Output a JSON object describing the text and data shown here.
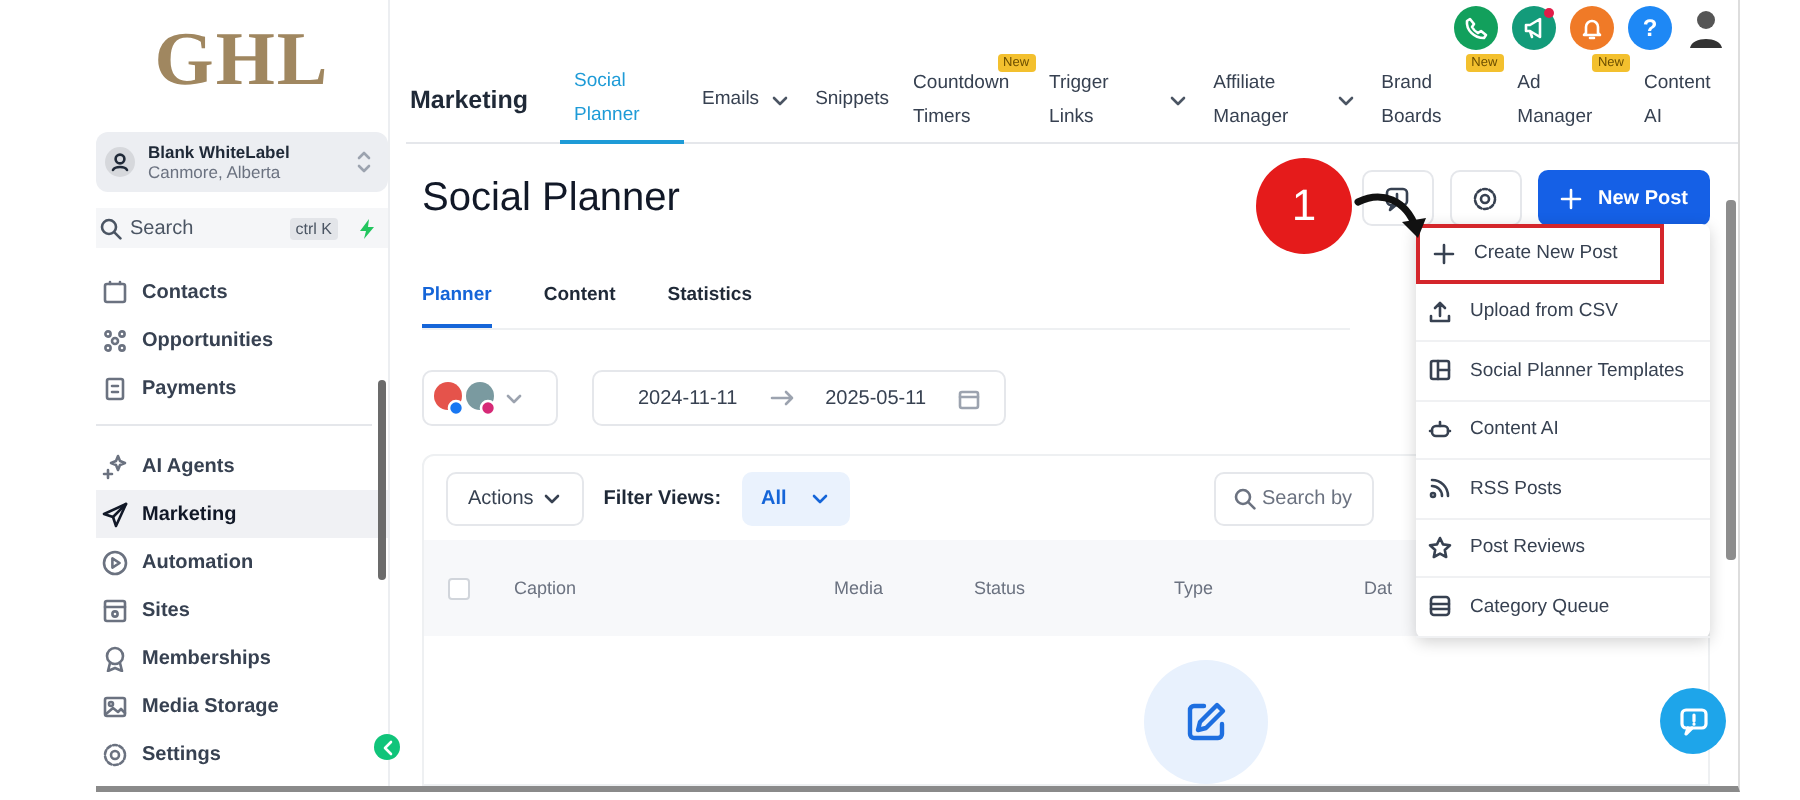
{
  "logo": {
    "text": "GHL"
  },
  "account": {
    "name": "Blank WhiteLabel",
    "location": "Canmore, Alberta"
  },
  "sidebar_search": {
    "placeholder": "Search",
    "shortcut": "ctrl K"
  },
  "sidebar": {
    "groups": [
      {
        "items": [
          {
            "label": "Contacts",
            "selected": false
          },
          {
            "label": "Opportunities",
            "selected": false
          },
          {
            "label": "Payments",
            "selected": false
          }
        ]
      },
      {
        "items": [
          {
            "label": "AI Agents",
            "selected": false
          },
          {
            "label": "Marketing",
            "selected": true
          },
          {
            "label": "Automation",
            "selected": false
          },
          {
            "label": "Sites",
            "selected": false
          },
          {
            "label": "Memberships",
            "selected": false
          },
          {
            "label": "Media Storage",
            "selected": false
          }
        ]
      }
    ],
    "settings": {
      "label": "Settings"
    }
  },
  "top_icons": {
    "announcements_unread": true,
    "help_symbol": "?"
  },
  "top_nav": {
    "section": "Marketing",
    "items": [
      {
        "label": "Social Planner",
        "selected": true,
        "dropdown": false
      },
      {
        "label": "Emails",
        "selected": false,
        "dropdown": true
      },
      {
        "label": "Snippets",
        "selected": false,
        "dropdown": false
      },
      {
        "label": "Countdown Timers",
        "selected": false,
        "dropdown": false,
        "badge": "New"
      },
      {
        "label": "Trigger Links",
        "selected": false,
        "dropdown": true
      },
      {
        "label": "Affiliate Manager",
        "selected": false,
        "dropdown": true
      },
      {
        "label": "Brand Boards",
        "selected": false,
        "dropdown": false,
        "badge": "New"
      },
      {
        "label": "Ad Manager",
        "selected": false,
        "dropdown": false,
        "badge": "New"
      },
      {
        "label": "Content AI",
        "selected": false,
        "dropdown": false
      }
    ]
  },
  "page": {
    "title": "Social Planner",
    "new_post_button": "New Post"
  },
  "new_post_menu": {
    "items": [
      {
        "label": "Create New Post",
        "highlighted": true
      },
      {
        "label": "Upload from CSV",
        "highlighted": false
      },
      {
        "label": "Social Planner Templates",
        "highlighted": false
      },
      {
        "label": "Content AI",
        "highlighted": false
      },
      {
        "label": "RSS Posts",
        "highlighted": false
      },
      {
        "label": "Post Reviews",
        "highlighted": false
      },
      {
        "label": "Category Queue",
        "highlighted": false
      }
    ]
  },
  "annotation": {
    "step": "1"
  },
  "tabs": [
    {
      "label": "Planner",
      "selected": true
    },
    {
      "label": "Content",
      "selected": false
    },
    {
      "label": "Statistics",
      "selected": false
    }
  ],
  "date_range": {
    "start": "2024-11-11",
    "end": "2025-05-11"
  },
  "table": {
    "actions": "Actions",
    "filter_label": "Filter Views:",
    "filter_value": "All",
    "search_placeholder": "Search by",
    "select_all": {
      "checked": false
    },
    "columns": [
      "Caption",
      "Media",
      "Status",
      "Type",
      "Dat"
    ]
  }
}
